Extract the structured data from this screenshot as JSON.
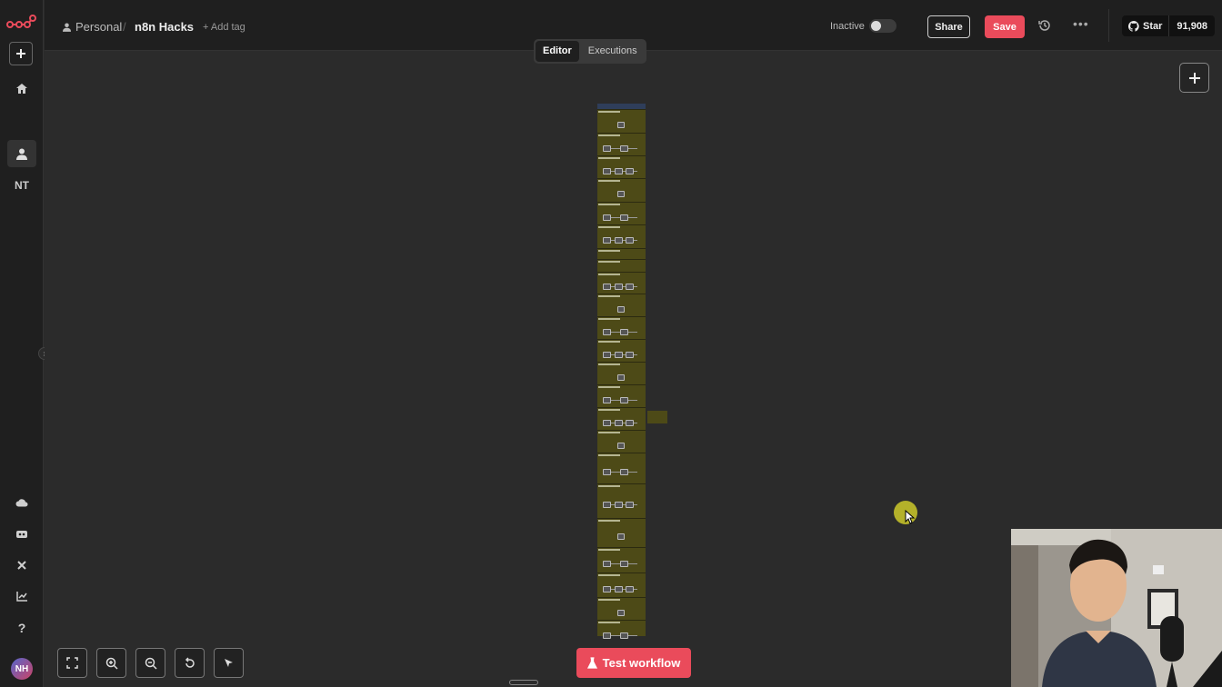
{
  "header": {
    "project_label": "Personal",
    "separator": "/",
    "workflow_name": "n8n Hacks",
    "add_tag_label": "+ Add tag",
    "status_label": "Inactive",
    "share_label": "Share",
    "save_label": "Save",
    "github_star_label": "Star",
    "github_star_count": "91,908"
  },
  "tabs": [
    {
      "label": "Editor",
      "active": true
    },
    {
      "label": "Executions",
      "active": false
    }
  ],
  "sidebar": {
    "project_initials": "NT",
    "user_initials": "NH"
  },
  "canvas": {
    "test_workflow_label": "Test workflow"
  },
  "colors": {
    "brand": "#ea4b5b",
    "background": "#2b2b2b",
    "sticky": "#4d4a17",
    "cursor_highlight": "#c3c02a"
  },
  "icons": [
    "n8n-logo",
    "plus-icon",
    "home-icon",
    "user-icon",
    "cloud-icon",
    "templates-icon",
    "variables-icon",
    "insights-icon",
    "help-icon",
    "history-icon",
    "more-icon",
    "github-icon",
    "zoom-to-fit-icon",
    "zoom-in-icon",
    "zoom-out-icon",
    "reset-zoom-icon",
    "pointer-icon",
    "flask-icon"
  ]
}
